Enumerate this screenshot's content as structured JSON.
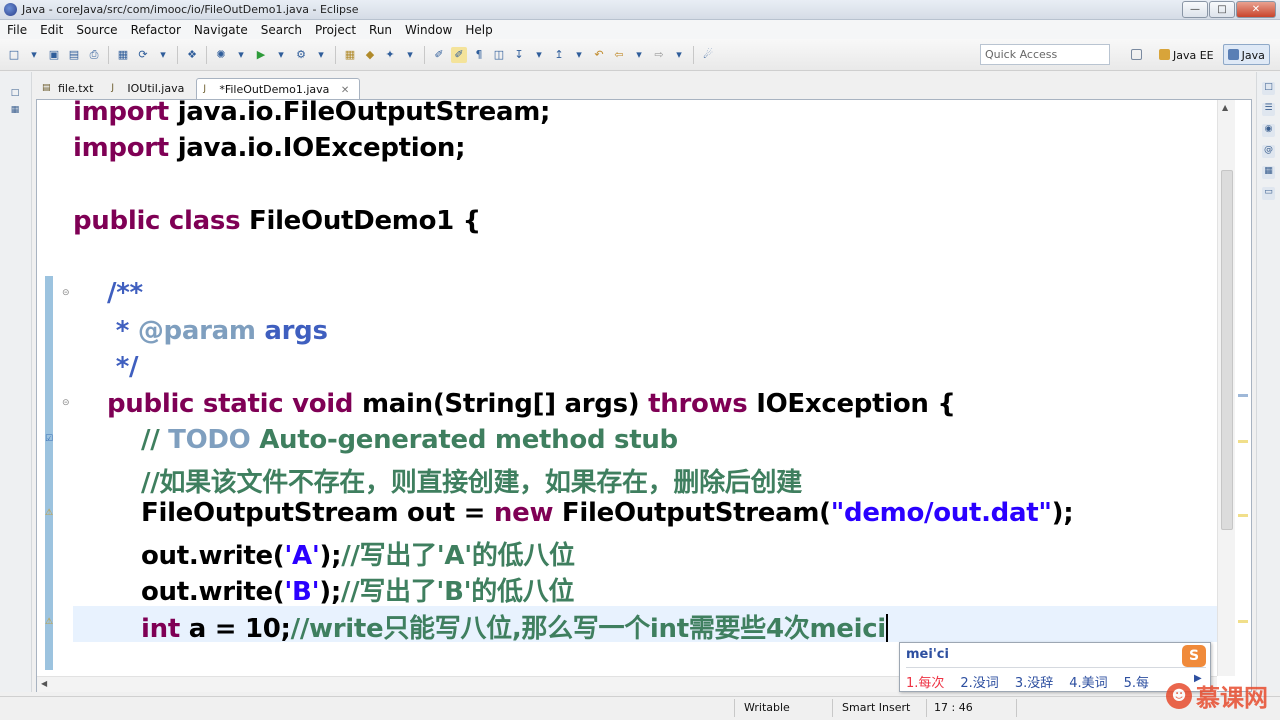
{
  "window": {
    "title": "Java - coreJava/src/com/imooc/io/FileOutDemo1.java - Eclipse"
  },
  "menu": [
    "File",
    "Edit",
    "Source",
    "Refactor",
    "Navigate",
    "Search",
    "Project",
    "Run",
    "Window",
    "Help"
  ],
  "toolbar": {
    "quick_access_placeholder": "Quick Access"
  },
  "perspectives": [
    {
      "label": "Java EE",
      "active": false
    },
    {
      "label": "Java",
      "active": true
    }
  ],
  "tabs": [
    {
      "label": "file.txt",
      "active": false
    },
    {
      "label": "IOUtil.java",
      "active": false
    },
    {
      "label": "*FileOutDemo1.java",
      "active": true
    }
  ],
  "code": {
    "l1": {
      "kw": "import",
      "rest": " java.io.FileOutputStream;"
    },
    "l2": {
      "kw": "import",
      "rest": " java.io.IOException;"
    },
    "l3": {
      "kw": "public class",
      "rest": " FileOutDemo1 {"
    },
    "l4": "/**",
    "l5": {
      "star": " * ",
      "tag": "@param",
      "arg": " args"
    },
    "l6": " */",
    "l7": {
      "kw1": "public static void",
      "mid": " main(String[] args) ",
      "kw2": "throws",
      "rest": " IOException {"
    },
    "l8": {
      "pre": "// ",
      "todo": "TODO",
      "rest": " Auto-generated method stub"
    },
    "l9": "//如果该文件不存在，则直接创建，如果存在，删除后创建",
    "l10": {
      "a": "FileOutputStream out = ",
      "kw": "new",
      "b": " FileOutputStream(",
      "str": "\"demo/out.dat\"",
      "c": ");"
    },
    "l11": {
      "a": "out.write(",
      "str": "'A'",
      "b": ");",
      "cm": "//写出了'A'的低八位"
    },
    "l12": {
      "a": "out.write(",
      "str": "'B'",
      "b": ");",
      "cm": "//写出了'B'的低八位"
    },
    "l13": {
      "kw": "int",
      "a": " a = 10;",
      "cm": "//write只能写八位,那么写一个int需要些4次meici"
    }
  },
  "ime": {
    "composition": "mei'ci",
    "logo": "S",
    "candidates": [
      "1.每次",
      "2.没词",
      "3.没辞",
      "4.美词",
      "5.每"
    ]
  },
  "status": {
    "writable": "Writable",
    "insert_mode": "Smart Insert",
    "position": "17 : 46"
  },
  "watermark": {
    "text": "慕课网"
  },
  "colors": {
    "keyword": "#7f0055",
    "comment": "#3f7f5f",
    "javadoc": "#3f5fbf",
    "string": "#2a00ff",
    "current_line": "#e8f2fe"
  }
}
